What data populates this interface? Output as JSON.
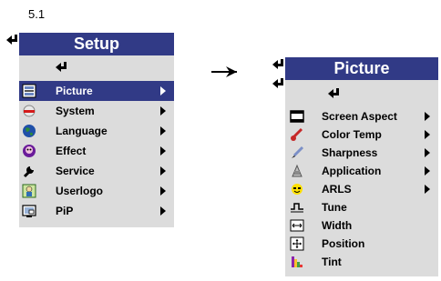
{
  "figure_label": "5.1",
  "setup_menu": {
    "title": "Setup",
    "items": [
      {
        "label": "Picture",
        "icon": "picture-icon",
        "has_submenu": true,
        "selected": true
      },
      {
        "label": "System",
        "icon": "system-icon",
        "has_submenu": true,
        "selected": false
      },
      {
        "label": "Language",
        "icon": "language-icon",
        "has_submenu": true,
        "selected": false
      },
      {
        "label": "Effect",
        "icon": "effect-icon",
        "has_submenu": true,
        "selected": false
      },
      {
        "label": "Service",
        "icon": "service-icon",
        "has_submenu": true,
        "selected": false
      },
      {
        "label": "Userlogo",
        "icon": "userlogo-icon",
        "has_submenu": true,
        "selected": false
      },
      {
        "label": "PiP",
        "icon": "pip-icon",
        "has_submenu": true,
        "selected": false
      }
    ]
  },
  "picture_menu": {
    "title": "Picture",
    "items": [
      {
        "label": "Screen Aspect",
        "icon": "screen-aspect-icon",
        "has_submenu": true
      },
      {
        "label": "Color Temp",
        "icon": "color-temp-icon",
        "has_submenu": true
      },
      {
        "label": "Sharpness",
        "icon": "sharpness-icon",
        "has_submenu": true
      },
      {
        "label": "Application",
        "icon": "application-icon",
        "has_submenu": true
      },
      {
        "label": "ARLS",
        "icon": "arls-icon",
        "has_submenu": true
      },
      {
        "label": "Tune",
        "icon": "tune-icon",
        "has_submenu": false
      },
      {
        "label": "Width",
        "icon": "width-icon",
        "has_submenu": false
      },
      {
        "label": "Position",
        "icon": "position-icon",
        "has_submenu": false
      },
      {
        "label": "Tint",
        "icon": "tint-icon",
        "has_submenu": false
      }
    ]
  },
  "colors": {
    "header_bg": "#313a86",
    "menu_bg": "#dcdcdc",
    "selected_bg": "#313a86"
  }
}
